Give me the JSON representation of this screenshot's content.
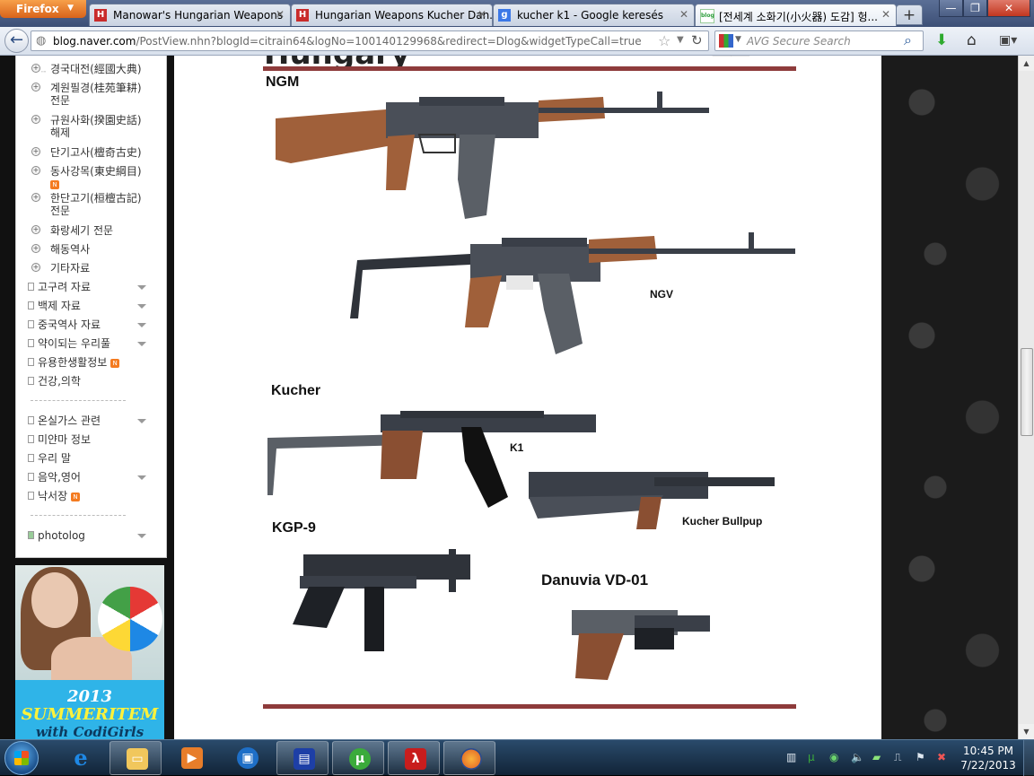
{
  "browser": {
    "app_button": "Firefox",
    "tabs": [
      {
        "title": "Manowar's Hungarian Weapons",
        "icon": "H"
      },
      {
        "title": "Hungarian Weapons Kucher Dan...",
        "icon": "H"
      },
      {
        "title": "kucher k1 - Google keresés",
        "icon": "g"
      },
      {
        "title": "[전세계 소화기(小火器) 도감] 헝...",
        "icon": "blog"
      }
    ],
    "new_tab": "+",
    "window_buttons": {
      "minimize": "—",
      "restore": "❐",
      "close": "✕"
    }
  },
  "navbar": {
    "url_domain": "blog.naver.com",
    "url_rest": "/PostView.nhn?blogId=citrain64&logNo=100140129968&redirect=Dlog&widgetTypeCall=true",
    "search_placeholder": "AVG Secure Search"
  },
  "sidebar": {
    "sub_items": [
      {
        "label": "경국대전(經國大典)"
      },
      {
        "label": "계원필경(桂苑筆耕)",
        "label2": "전문"
      },
      {
        "label": "규원사화(揆園史話)",
        "label2": "해제"
      },
      {
        "label": "단기고사(檀奇古史)"
      },
      {
        "label": "동사강목(東史綱目)",
        "badge": "N"
      },
      {
        "label": "한단고기(桓檀古記)",
        "label2": "전문"
      },
      {
        "label": "화랑세기 전문"
      },
      {
        "label": "해동역사"
      },
      {
        "label": "기타자료"
      }
    ],
    "categories": [
      {
        "label": "고구려 자료",
        "dropdown": true
      },
      {
        "label": "백제 자료",
        "dropdown": true
      },
      {
        "label": "중국역사 자료",
        "dropdown": true
      },
      {
        "label": "약이되는 우리풀",
        "dropdown": true
      },
      {
        "label": "유용한생활정보",
        "badge": "N"
      },
      {
        "label": "건강,의학"
      }
    ],
    "categories2": [
      {
        "label": "온실가스 관련",
        "dropdown": true
      },
      {
        "label": "미얀마 정보"
      },
      {
        "label": "우리 말"
      },
      {
        "label": "음악,영어",
        "dropdown": true
      },
      {
        "label": "낙서장",
        "badge": "N"
      }
    ],
    "photolog": "photolog"
  },
  "ad": {
    "line1": "2013",
    "line2": "SUMMERITEM",
    "line3": "with CodiGirls"
  },
  "post": {
    "heading_partial": "Hungary",
    "labels": {
      "ngm": "NGM",
      "ngv": "NGV",
      "kucher": "Kucher",
      "k1": "K1",
      "kucher_bullpup": "Kucher Bullpup",
      "kgp9": "KGP-9",
      "danuvia": "Danuvia VD-01"
    }
  },
  "taskbar": {
    "apps": [
      "internet-explorer",
      "windows-explorer",
      "media-player",
      "windows-update",
      "save-disk",
      "utorrent",
      "adobe-reader",
      "firefox"
    ],
    "clock_time": "10:45 PM",
    "clock_date": "7/22/2013"
  },
  "colors": {
    "rule": "#8e3b3b",
    "wood": "#a0603a",
    "metal": "#4a4f58",
    "firefox_orange": "#e8782b"
  }
}
